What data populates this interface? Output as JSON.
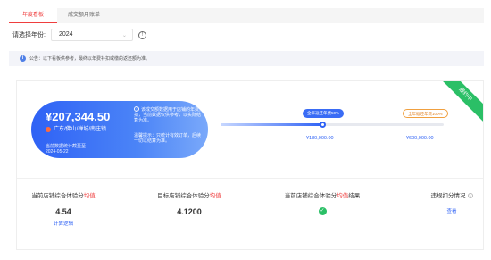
{
  "tabs": [
    {
      "label": "年度看板",
      "active": true
    },
    {
      "label": "成交额月账单",
      "active": false
    }
  ],
  "filter": {
    "year_label": "请选择年份:",
    "year_value": "2024"
  },
  "notice": {
    "text": "公告：以下看板供参考，最终以年费补扣或缴的返还额为准。"
  },
  "panel": {
    "ribbon": "履约中",
    "card": {
      "amount": "¥207,344.50",
      "region": "广东/佛山/禅城/南庄镇",
      "cutoff_line1": "当前数据统计截至至",
      "cutoff_line2": "2024-05-22",
      "note": "该成交额数据用于店铺的年费抵扣，当前数据仅供参考，以实际结算为准。",
      "tip": "温馨提示：只统计有效订单，后续一切以结算为准。"
    },
    "progress": {
      "fraction": 0.46,
      "tiers": [
        {
          "tag": "全年返还年费50%",
          "value": "¥180,000.00"
        },
        {
          "tag": "全年返还年费100%",
          "value": "¥600,000.00"
        }
      ]
    },
    "metrics": [
      {
        "label_pre": "当前店铺综合体验分",
        "label_hl": "均值",
        "label_post": "",
        "value": "4.54",
        "link": "计算逻辑"
      },
      {
        "label_pre": "目标店铺综合体验分",
        "label_hl": "均值",
        "label_post": "",
        "value": "4.1200"
      },
      {
        "label_pre": "当前店铺综合体验分",
        "label_hl": "均值",
        "label_post": "结果"
      },
      {
        "label": "违规扣分情况",
        "link": "查看"
      }
    ]
  },
  "colors": {
    "accent_red": "#ef3e3e",
    "accent_blue": "#2f62f5",
    "success_green": "#2bbf66"
  }
}
